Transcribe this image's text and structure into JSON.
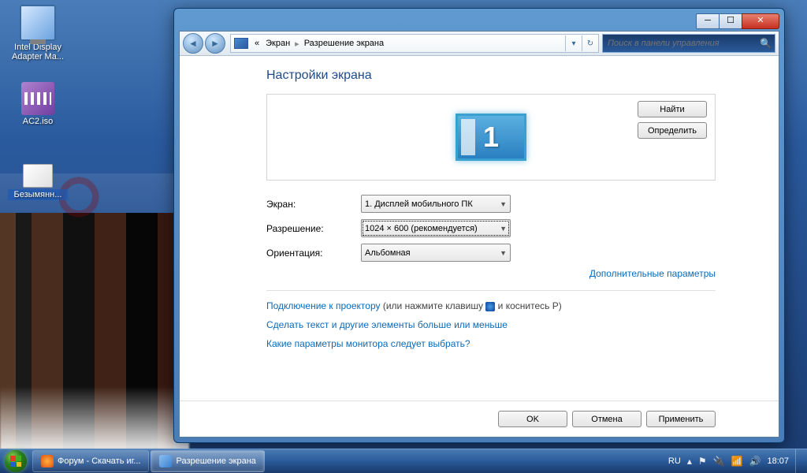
{
  "desktop": {
    "icons": [
      {
        "label": "Intel Display Adapter Ma..."
      },
      {
        "label": "AC2.iso"
      },
      {
        "label": "Безымянн..."
      }
    ]
  },
  "window": {
    "breadcrumb": {
      "prefix": "«",
      "item1": "Экран",
      "item2": "Разрешение экрана"
    },
    "search_placeholder": "Поиск в панели управления",
    "title": "Настройки экрана",
    "monitor_number": "1",
    "btn_find": "Найти",
    "btn_identify": "Определить",
    "labels": {
      "screen": "Экран:",
      "resolution": "Разрешение:",
      "orientation": "Ориентация:"
    },
    "selects": {
      "screen": "1. Дисплей мобильного ПК",
      "resolution": "1024 × 600 (рекомендуется)",
      "orientation": "Альбомная"
    },
    "advanced_link": "Дополнительные параметры",
    "projector": {
      "link": "Подключение к проектору",
      "text1": " (или нажмите клавишу ",
      "text2": " и коснитесь P)"
    },
    "text_size_link": "Сделать текст и другие элементы больше или меньше",
    "which_params_link": "Какие параметры монитора следует выбрать?",
    "btn_ok": "OK",
    "btn_cancel": "Отмена",
    "btn_apply": "Применить"
  },
  "taskbar": {
    "task_firefox": "Форум - Скачать иг...",
    "task_active": "Разрешение экрана",
    "lang": "RU",
    "clock": "18:07"
  }
}
